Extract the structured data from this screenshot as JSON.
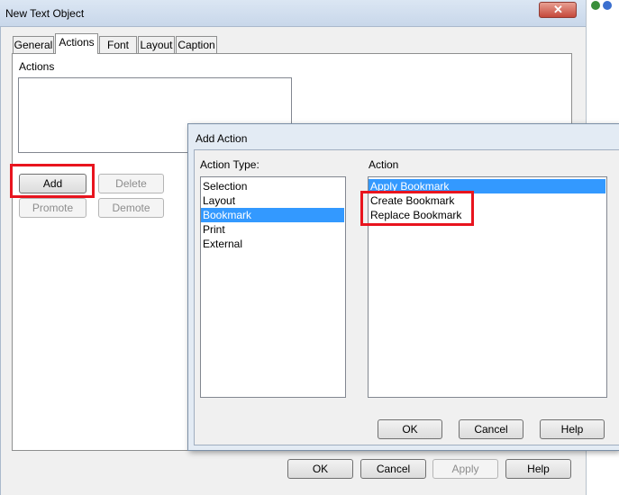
{
  "main_window": {
    "title": "New Text Object",
    "tabs": [
      "General",
      "Actions",
      "Font",
      "Layout",
      "Caption"
    ],
    "active_tab": "Actions",
    "actions_group_label": "Actions",
    "buttons": {
      "add": "Add",
      "delete": "Delete",
      "promote": "Promote",
      "demote": "Demote",
      "ok": "OK",
      "cancel": "Cancel",
      "apply": "Apply",
      "help": "Help"
    }
  },
  "add_action_dialog": {
    "title": "Add Action",
    "action_type_label": "Action Type:",
    "action_label": "Action",
    "action_types": [
      "Selection",
      "Layout",
      "Bookmark",
      "Print",
      "External"
    ],
    "selected_action_type": "Bookmark",
    "actions": [
      "Apply Bookmark",
      "Create Bookmark",
      "Replace Bookmark"
    ],
    "selected_action": "Apply Bookmark",
    "buttons": {
      "ok": "OK",
      "cancel": "Cancel",
      "help": "Help"
    }
  },
  "colors": {
    "highlight_box": "#e8141e",
    "selection": "#3399ff"
  }
}
